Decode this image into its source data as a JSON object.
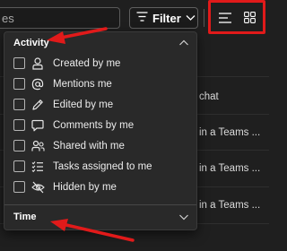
{
  "toolbar": {
    "search_partial_text": "es",
    "filter_label": "Filter"
  },
  "list": {
    "rows": [
      {
        "text": ""
      },
      {
        "text": "chat"
      },
      {
        "text": "in a Teams ..."
      },
      {
        "text": "in a Teams ..."
      },
      {
        "text": "in a Teams ..."
      }
    ]
  },
  "dropdown": {
    "activity_title": "Activity",
    "options": [
      {
        "label": "Created by me",
        "icon": "person-icon",
        "checked": false
      },
      {
        "label": "Mentions me",
        "icon": "at-sign-icon",
        "checked": false
      },
      {
        "label": "Edited by me",
        "icon": "pencil-icon",
        "checked": false
      },
      {
        "label": "Comments by me",
        "icon": "comment-icon",
        "checked": false
      },
      {
        "label": "Shared with me",
        "icon": "people-icon",
        "checked": false
      },
      {
        "label": "Tasks assigned to me",
        "icon": "task-list-icon",
        "checked": false
      },
      {
        "label": "Hidden by me",
        "icon": "eye-off-icon",
        "checked": false
      }
    ],
    "time_title": "Time"
  },
  "colors": {
    "background": "#1f1f1f",
    "dropdown_bg": "#292929",
    "annotation_red": "#e11a1a",
    "text": "#ececec"
  }
}
